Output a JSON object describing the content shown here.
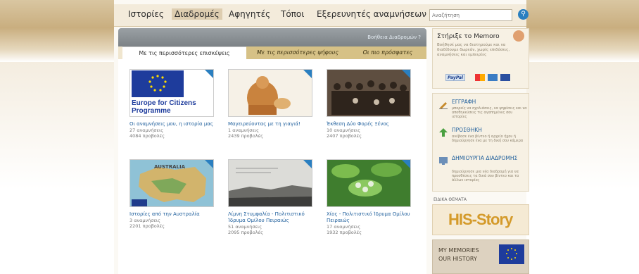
{
  "nav": {
    "items": [
      "Ιστορίες",
      "Διαδρομές",
      "Αφηγητές",
      "Τόποι",
      "Εξερευνητές αναμνήσεων"
    ],
    "active": "Διαδρομές"
  },
  "search": {
    "placeholder": "Αναζήτηση"
  },
  "main": {
    "help_link": "Βοήθεια Διαδρομών ?",
    "tabs": [
      "Με τις περισσότερες επισκέψεις",
      "Με τις περισσότερες ψήφους",
      "Οι πιο πρόσφατες"
    ],
    "active_tab": "Με τις περισσότερες επισκέψεις",
    "cards": [
      {
        "image_text": "Europe for Citizens Programme",
        "title": "Οι αναμνήσεις μου, η ιστορία μας",
        "memories": "27 αναμνήσεις",
        "views": "4084 προβολές"
      },
      {
        "title": "Μαγειρεύοντας με τη γιαγιά!",
        "memories": "1 αναμνήσεις",
        "views": "2439 προβολές"
      },
      {
        "title": "Έκθεση Δύο Φορές Ξένος",
        "memories": "10 αναμνήσεις",
        "views": "2407 προβολές"
      },
      {
        "image_text": "AUSTRALIA",
        "title": "Ιστορίες από την Αυστραλία",
        "memories": "3 αναμνήσεις",
        "views": "2201 προβολές"
      },
      {
        "title": "Λίμνη Στυμφαλία - Πολιτιστικό Ίδρυμα Ομίλου Πειραιώς",
        "memories": "51 αναμνήσεις",
        "views": "2095 προβολές"
      },
      {
        "title": "Χίος - Πολιτιστικό Ίδρυμα Ομίλου Πειραιώς",
        "memories": "17 αναμνήσεις",
        "views": "1932 προβολές"
      }
    ]
  },
  "sidebar": {
    "support": {
      "title": "Στήριξε το Memoro",
      "text": "Βοήθησέ μας να διατηρούμε και να διαδίδουμε δωρεάν, χωρίς επιδόσεις, αναμνήσεις και εμπειρίες"
    },
    "actions": [
      {
        "label": "ΕΓΓΡΑΦΗ",
        "desc": "μπορείς να σχολιάσεις, να ψηφίσεις και να αποθηκεύσεις τις αγαπημένες σου ιστορίες"
      },
      {
        "label": "ΠΡΟΣΘΗΚΗ",
        "desc": "ανέβασε ένα βίντεο ή αρχείο ήχου ή δημιούργησε ένα με τη δική σου κάμερα"
      },
      {
        "label": "ΔΗΜΙΟΥΡΓΙΑ ΔΙΑΔΡΟΜΗΣ",
        "desc": "δημιούργησε μια νέα διαδρομή για να προσθέσεις τα δικά σου βίντεο και τα άλλων ιστορίες"
      }
    ],
    "special_label": "ΕΙΔΙΚΑ ΘΕΜΑΤΑ",
    "banner1": "HIS-Story",
    "banner2_line1": "MY MEMORIES",
    "banner2_line2": "OUR HISTORY"
  },
  "colors": {
    "accent_blue": "#2a7fc0",
    "tab_gold": "#d6c186",
    "link_blue": "#1f5f9c"
  }
}
